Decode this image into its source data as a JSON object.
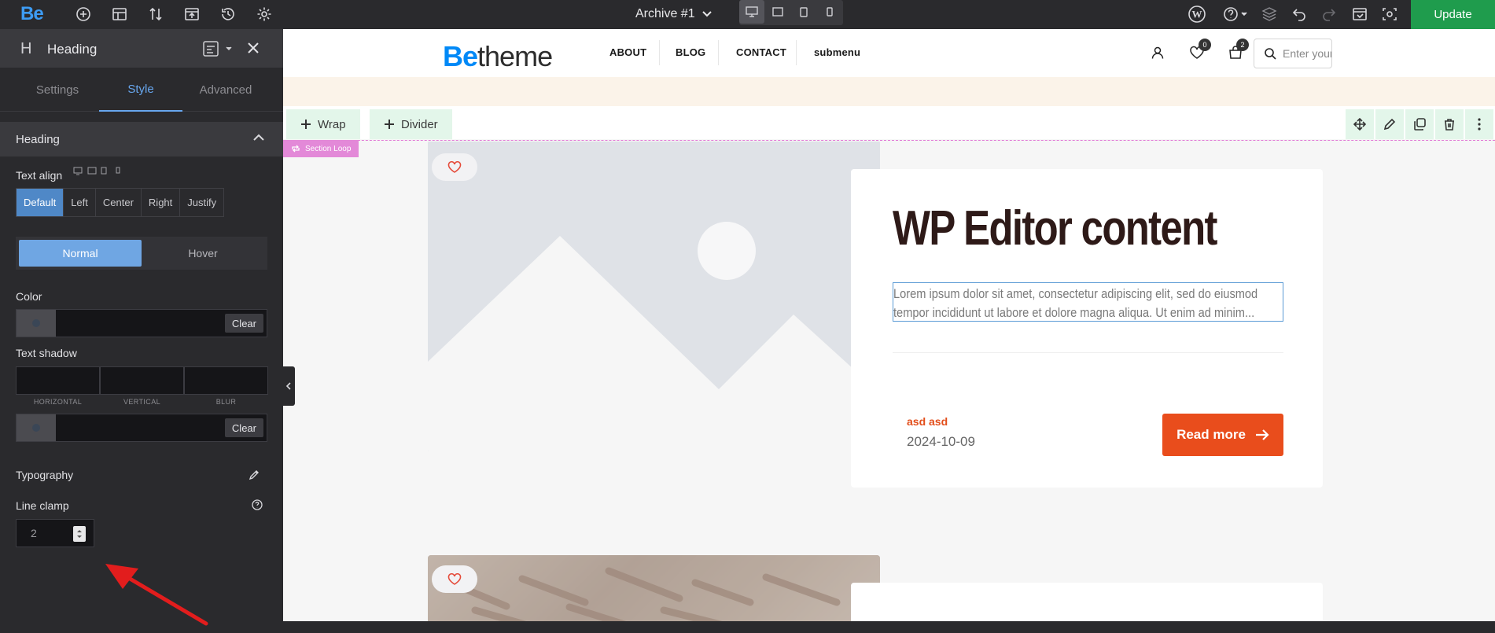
{
  "topbar": {
    "logo": "Be",
    "doc_title": "Archive #1",
    "update_label": "Update",
    "devices": [
      "desktop",
      "laptop",
      "tablet",
      "mobile"
    ],
    "active_device": "desktop"
  },
  "sidebar": {
    "title": "Heading",
    "tabs": [
      "Settings",
      "Style",
      "Advanced"
    ],
    "active_tab": "Style",
    "section_title": "Heading",
    "text_align": {
      "label": "Text align",
      "options": [
        "Default",
        "Left",
        "Center",
        "Right",
        "Justify"
      ],
      "selected": "Default"
    },
    "state_toggle": {
      "options": [
        "Normal",
        "Hover"
      ],
      "selected": "Normal"
    },
    "color": {
      "label": "Color",
      "clear": "Clear"
    },
    "text_shadow": {
      "label": "Text shadow",
      "fields": [
        "HORIZONTAL",
        "VERTICAL",
        "BLUR"
      ],
      "clear": "Clear"
    },
    "typography_label": "Typography",
    "line_clamp": {
      "label": "Line clamp",
      "value": "2"
    }
  },
  "site": {
    "brand_be": "Be",
    "brand_rest": "theme",
    "nav": [
      "ABOUT",
      "BLOG",
      "CONTACT",
      "submenu"
    ],
    "wishlist_count": "0",
    "cart_count": "2",
    "search_placeholder": "Enter your search"
  },
  "builder": {
    "add_wrap": "Wrap",
    "add_divider": "Divider",
    "section_label": "Section Loop"
  },
  "post": {
    "title": "WP Editor content",
    "excerpt": "Lorem ipsum dolor sit amet, consectetur adipiscing elit, sed do eiusmod tempor incididunt ut labore et dolore magna aliqua. Ut enim ad minim...",
    "author": "asd asd",
    "date": "2024-10-09",
    "read_more": "Read more"
  },
  "colors": {
    "accent_blue": "#67a6ee",
    "update_green": "#1f9c4d",
    "read_more": "#e94d1c",
    "section_pink": "#e389d8"
  }
}
